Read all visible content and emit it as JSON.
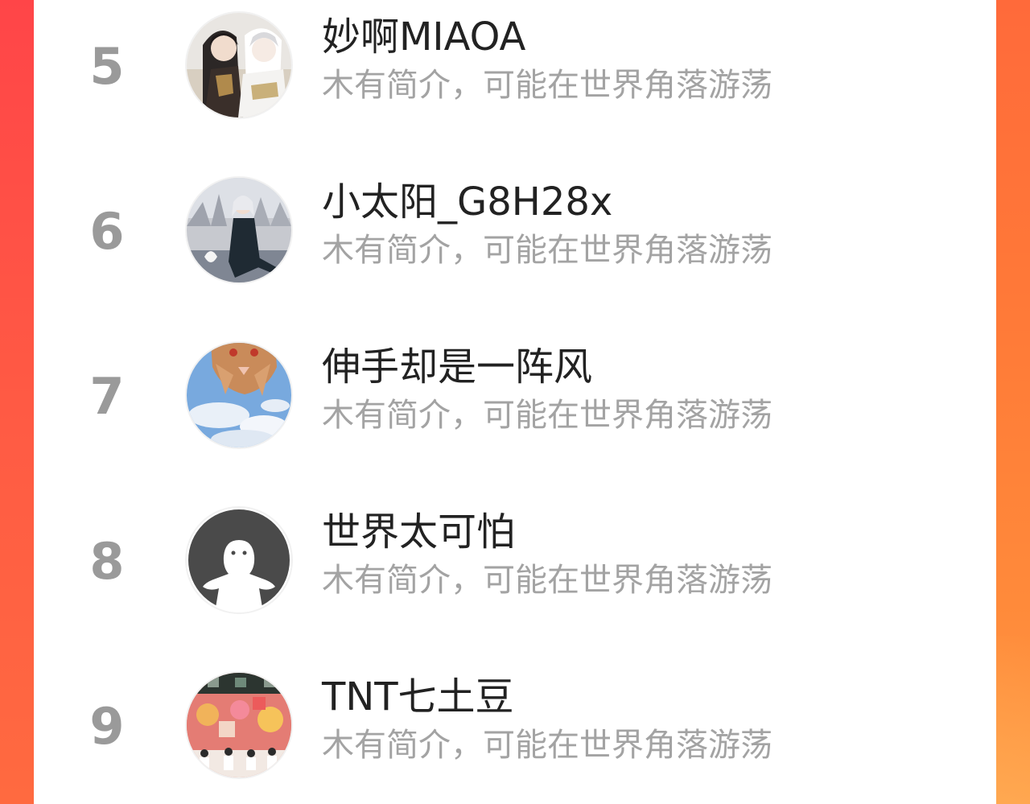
{
  "colors": {
    "rank_text": "#9a9a9a",
    "name_text": "#222222",
    "bio_text": "#a3a3a3",
    "accent_left": "#ff4548",
    "accent_right": "#ff8a3a"
  },
  "ranking_list": [
    {
      "rank": "5",
      "name": "妙啊MIAOA",
      "bio": "木有简介，可能在世界角落游荡",
      "avatar_icon": "anime-duo-avatar"
    },
    {
      "rank": "6",
      "name": "小太阳_G8H28x",
      "bio": "木有简介，可能在世界角落游荡",
      "avatar_icon": "girl-in-dress-avatar"
    },
    {
      "rank": "7",
      "name": "伸手却是一阵风",
      "bio": "木有简介，可能在世界角落游荡",
      "avatar_icon": "cat-sky-avatar"
    },
    {
      "rank": "8",
      "name": "世界太可怕",
      "bio": "木有简介，可能在世界角落游荡",
      "avatar_icon": "default-user-avatar"
    },
    {
      "rank": "9",
      "name": "TNT七土豆",
      "bio": "木有简介，可能在世界角落游荡",
      "avatar_icon": "group-photo-avatar"
    }
  ]
}
